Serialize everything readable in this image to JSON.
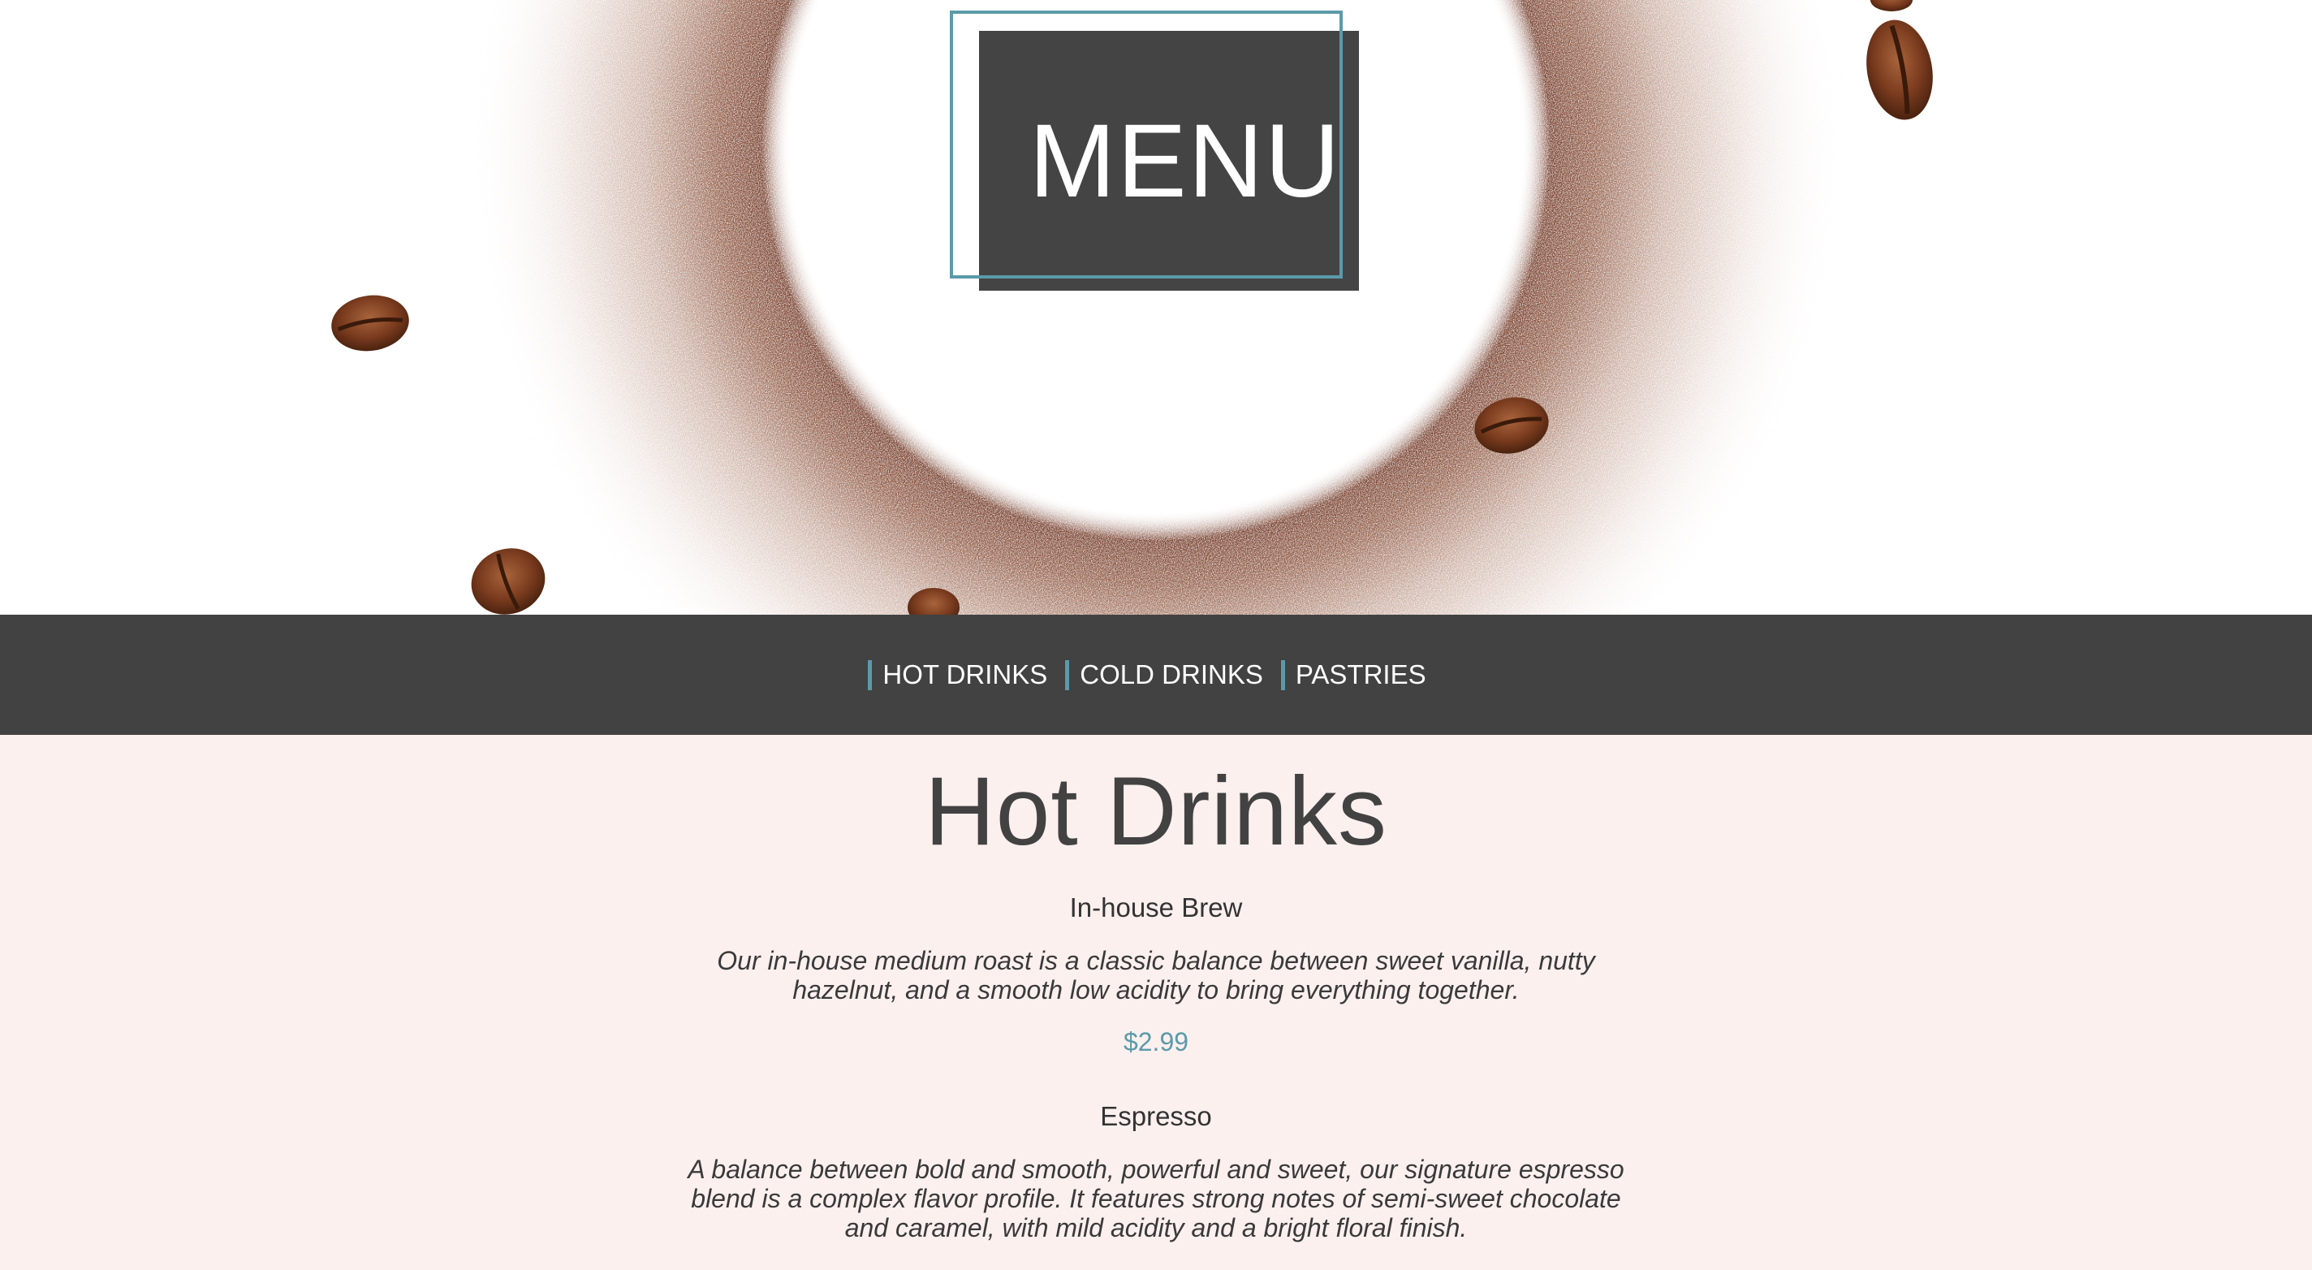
{
  "hero": {
    "title": "MENU",
    "image_alt": "Ground coffee ring with coffee beans"
  },
  "nav": {
    "items": [
      {
        "label": "HOT DRINKS"
      },
      {
        "label": "COLD DRINKS"
      },
      {
        "label": "PASTRIES"
      }
    ]
  },
  "section": {
    "title": "Hot Drinks",
    "items": [
      {
        "name": "In-house Brew",
        "description": "Our in-house medium roast is a classic balance between sweet vanilla, nutty hazelnut, and a smooth low acidity to bring everything together.",
        "price": "$2.99"
      },
      {
        "name": "Espresso",
        "description": "A balance between bold and smooth, powerful and sweet, our signature espresso blend is a complex flavor profile. It features strong notes of semi-sweet chocolate and caramel, with mild acidity and a bright floral finish.",
        "price": ""
      }
    ]
  },
  "colors": {
    "dark": "#424242",
    "accent": "#5b9aaa",
    "page_bg": "#fbf0ee",
    "coffee": "#7a3b22"
  }
}
